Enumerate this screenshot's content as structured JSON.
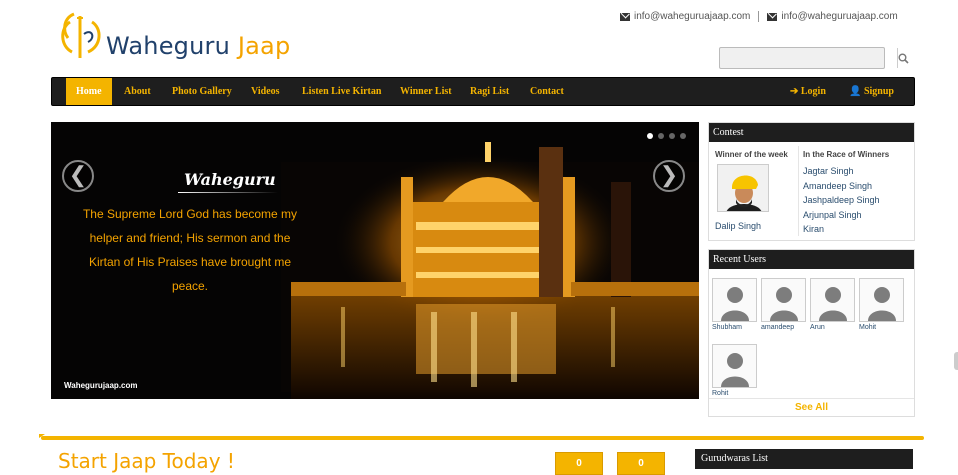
{
  "brand": {
    "name_part1": "Waheguru",
    "name_part2": "Jaap"
  },
  "header": {
    "contacts": [
      "info@waheguruajaap.com",
      "info@waheguruajaap.com"
    ],
    "search_placeholder": ""
  },
  "nav": {
    "items": [
      "Home",
      "About",
      "Photo Gallery",
      "Videos",
      "Listen Live Kirtan",
      "Winner List",
      "Ragi List",
      "Contact"
    ],
    "login": "Login",
    "signup": "Signup"
  },
  "slider": {
    "title": "Waheguru",
    "quote": "The Supreme Lord God has become my helper and friend; His sermon and the Kirtan of His Praises have brought me peace.",
    "site": "Wahegurujaap.com",
    "prev": "❮",
    "next": "❯",
    "slide_count": 4,
    "active_slide": 1
  },
  "contest": {
    "heading": "Contest",
    "winner_heading": "Winner of the week",
    "winner_name": "Dalip Singh",
    "race_heading": "In the Race of Winners",
    "race": [
      "Jagtar Singh",
      "Amandeep Singh",
      "Jashpaldeep Singh",
      "Arjunpal Singh",
      "Kiran"
    ]
  },
  "recent_users": {
    "heading": "Recent Users",
    "users": [
      "Shubham",
      "amandeep",
      "Arun",
      "Mohit",
      "Rohit"
    ],
    "see_all": "See All"
  },
  "bottom": {
    "start_part1": "Start",
    "start_part2": "Jaap Today !",
    "counters": [
      "0",
      "0"
    ],
    "gurdwaras_heading": "Gurudwaras List"
  },
  "colors": {
    "accent": "#f4b400",
    "dark": "#1e1e1e",
    "link": "#2a4d6e",
    "brand_blue": "#21416b"
  }
}
